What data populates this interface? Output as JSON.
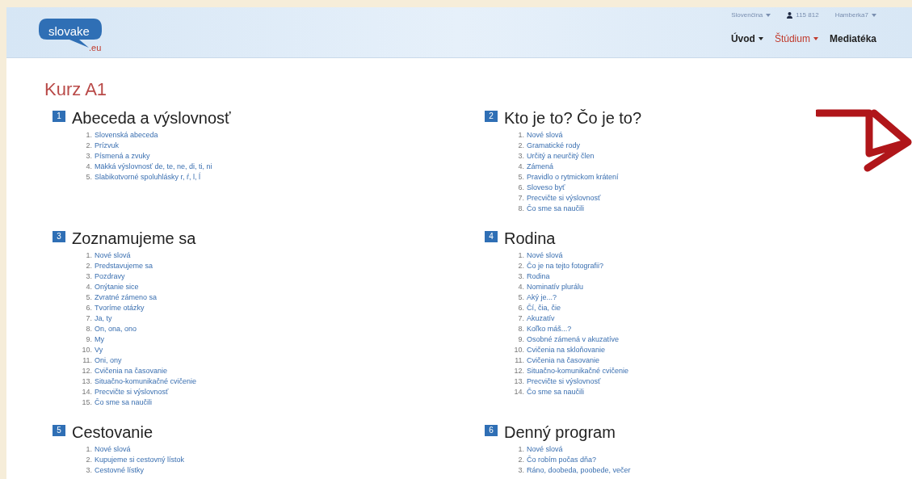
{
  "header": {
    "logo": {
      "name": "slovake",
      "suffix": ".eu"
    },
    "top_links": [
      {
        "kind": "dropdown",
        "label": "Slovenčina"
      },
      {
        "kind": "user",
        "label": "115 812"
      },
      {
        "kind": "dropdown",
        "label": "Hamberka7"
      }
    ],
    "nav": [
      {
        "label": "Úvod",
        "selected": false,
        "dropdown": true
      },
      {
        "label": "Štúdium",
        "selected": true,
        "dropdown": true
      },
      {
        "label": "Mediatéka",
        "selected": false,
        "dropdown": false
      }
    ]
  },
  "course_title": "Kurz A1",
  "sections": [
    {
      "number": "1",
      "title": "Abeceda a výslovnosť",
      "lessons": [
        {
          "num": "1.",
          "label": "Slovenská abeceda"
        },
        {
          "num": "2.",
          "label": "Prízvuk"
        },
        {
          "num": "3.",
          "label": "Písmená a zvuky"
        },
        {
          "num": "4.",
          "label": "Mäkká výslovnosť de, te, ne, di, ti, ni"
        },
        {
          "num": "5.",
          "label": "Slabikotvorné spoluhlásky r, ŕ, l, ĺ"
        }
      ]
    },
    {
      "number": "2",
      "title": "Kto je to? Čo je to?",
      "lessons": [
        {
          "num": "1.",
          "label": "Nové slová"
        },
        {
          "num": "2.",
          "label": "Gramatické rody"
        },
        {
          "num": "3.",
          "label": "Určitý a neurčitý člen"
        },
        {
          "num": "4.",
          "label": "Zámená"
        },
        {
          "num": "5.",
          "label": "Pravidlo o rytmickom krátení"
        },
        {
          "num": "6.",
          "label": "Sloveso byť"
        },
        {
          "num": "7.",
          "label": "Precvičte si výslovnosť"
        },
        {
          "num": "8.",
          "label": "Čo sme sa naučili"
        }
      ]
    },
    {
      "number": "3",
      "title": "Zoznamujeme sa",
      "lessons": [
        {
          "num": "1.",
          "label": "Nové slová"
        },
        {
          "num": "2.",
          "label": "Predstavujeme sa"
        },
        {
          "num": "3.",
          "label": "Pozdravy"
        },
        {
          "num": "4.",
          "label": "Onýtanie sice"
        },
        {
          "num": "5.",
          "label": "Zvratné zámeno sa"
        },
        {
          "num": "6.",
          "label": "Tvoríme otázky"
        },
        {
          "num": "7.",
          "label": "Ja, ty"
        },
        {
          "num": "8.",
          "label": "On, ona, ono"
        },
        {
          "num": "9.",
          "label": "My"
        },
        {
          "num": "10.",
          "label": "Vy"
        },
        {
          "num": "11.",
          "label": "Oni, ony"
        },
        {
          "num": "12.",
          "label": "Cvičenia na časovanie"
        },
        {
          "num": "13.",
          "label": "Situačno-komunikačné cvičenie"
        },
        {
          "num": "14.",
          "label": "Precvičte si výslovnosť"
        },
        {
          "num": "15.",
          "label": "Čo sme sa naučili"
        }
      ]
    },
    {
      "number": "4",
      "title": "Rodina",
      "lessons": [
        {
          "num": "1.",
          "label": "Nové slová"
        },
        {
          "num": "2.",
          "label": "Čo je na tejto fotografii?"
        },
        {
          "num": "3.",
          "label": "Rodina"
        },
        {
          "num": "4.",
          "label": "Nominatív plurálu"
        },
        {
          "num": "5.",
          "label": "Aký je...?"
        },
        {
          "num": "6.",
          "label": "Čí, čia, čie"
        },
        {
          "num": "7.",
          "label": "Akuzatív"
        },
        {
          "num": "8.",
          "label": "Koľko máš...?"
        },
        {
          "num": "9.",
          "label": "Osobné zámená v akuzatíve"
        },
        {
          "num": "10.",
          "label": "Cvičenia na skloňovanie"
        },
        {
          "num": "11.",
          "label": "Cvičenia na časovanie"
        },
        {
          "num": "12.",
          "label": "Situačno-komunikačné cvičenie"
        },
        {
          "num": "13.",
          "label": "Precvičte si výslovnosť"
        },
        {
          "num": "14.",
          "label": "Čo sme sa naučili"
        }
      ]
    },
    {
      "number": "5",
      "title": "Cestovanie",
      "lessons": [
        {
          "num": "1.",
          "label": "Nové slová"
        },
        {
          "num": "2.",
          "label": "Kupujeme si cestovný lístok"
        },
        {
          "num": "3.",
          "label": "Cestovné lístky"
        }
      ]
    },
    {
      "number": "6",
      "title": "Denný program",
      "lessons": [
        {
          "num": "1.",
          "label": "Nové slová"
        },
        {
          "num": "2.",
          "label": "Čo robím počas dňa?"
        },
        {
          "num": "3.",
          "label": "Ráno, doobeda, poobede, večer"
        }
      ]
    }
  ]
}
